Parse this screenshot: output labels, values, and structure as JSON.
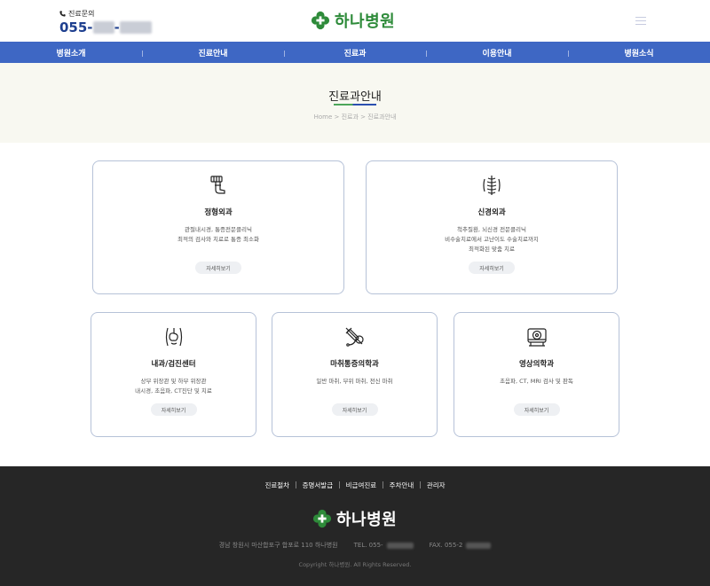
{
  "header": {
    "phone_label": "진료문의",
    "phone_prefix": "055-",
    "phone_dash": "-",
    "logo_text": "하나병원"
  },
  "nav": {
    "items": [
      "병원소개",
      "진료안내",
      "진료과",
      "이용안내",
      "병원소식"
    ]
  },
  "title_band": {
    "title": "진료과안내",
    "breadcrumb": "Home > 진료과 > 진료과안내"
  },
  "departments": [
    {
      "icon": "orthopedic-brace-icon",
      "title": "정형외과",
      "desc_lines": [
        "관절내시경, 통증전문클리닉",
        "최적의 검사와 치료로 통증 최소화"
      ],
      "button": "자세히보기"
    },
    {
      "icon": "spine-icon",
      "title": "신경외과",
      "desc_lines": [
        "척추질환, 뇌신경 전문클리닉",
        "비수술치료에서 고난이도 수술치료까지",
        "최적화된 맞춤 치료"
      ],
      "button": "자세히보기"
    },
    {
      "icon": "torso-organs-icon",
      "title": "내과/검진센터",
      "desc_lines": [
        "상부 위장관 및 하부 위장관",
        "내시경, 초음파, CT진단 및 치료"
      ],
      "button": "자세히보기"
    },
    {
      "icon": "syringe-stethoscope-icon",
      "title": "마취통증의학과",
      "desc_lines": [
        "일반 마취, 부위 마취, 전신 마취"
      ],
      "button": "자세히보기"
    },
    {
      "icon": "scanner-icon",
      "title": "영상의학과",
      "desc_lines": [
        "초음파, CT, MRI 검사 및 판독"
      ],
      "button": "자세히보기"
    }
  ],
  "footer": {
    "links": [
      "진료절차",
      "증명서발급",
      "비급여진료",
      "주차안내",
      "관리자"
    ],
    "logo_text": "하나병원",
    "address": "경남 창원시 마산합포구 합포로 110 하나병원",
    "tel_label": "TEL. 055-",
    "fax_label": "FAX. 055-2",
    "copyright": "Copyright 하나병원. All Rights Reserved."
  },
  "colors": {
    "nav_blue": "#3e67c4",
    "logo_green": "#2e8b3a",
    "card_border": "#b6c2d8",
    "footer_bg": "#262626",
    "title_band_bg": "#f8f8f1"
  }
}
